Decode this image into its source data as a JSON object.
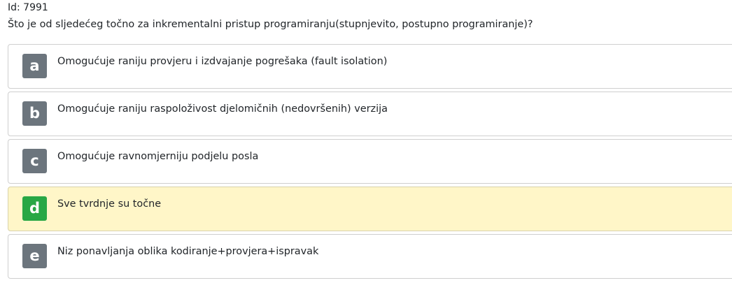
{
  "question": {
    "id_label": "Id: 7991",
    "text": "Što je od sljedećeg točno za inkrementalni pristup programiranju(stupnjevito, postupno programiranje)?"
  },
  "answers": [
    {
      "letter": "a",
      "text": "Omogućuje raniju provjeru i izdvajanje pogrešaka (fault isolation)",
      "selected": false
    },
    {
      "letter": "b",
      "text": "Omogućuje raniju raspoloživost djelomičnih (nedovršenih) verzija",
      "selected": false
    },
    {
      "letter": "c",
      "text": "Omogućuje ravnomjerniju podjelu posla",
      "selected": false
    },
    {
      "letter": "d",
      "text": "Sve tvrdnje su točne",
      "selected": true
    },
    {
      "letter": "e",
      "text": "Niz ponavljanja oblika kodiranje+provjera+ispravak",
      "selected": false
    }
  ],
  "colors": {
    "badge_default": "#6c757d",
    "badge_selected": "#28a745",
    "selected_background": "#fff6c8",
    "border": "#cfcfcf"
  }
}
